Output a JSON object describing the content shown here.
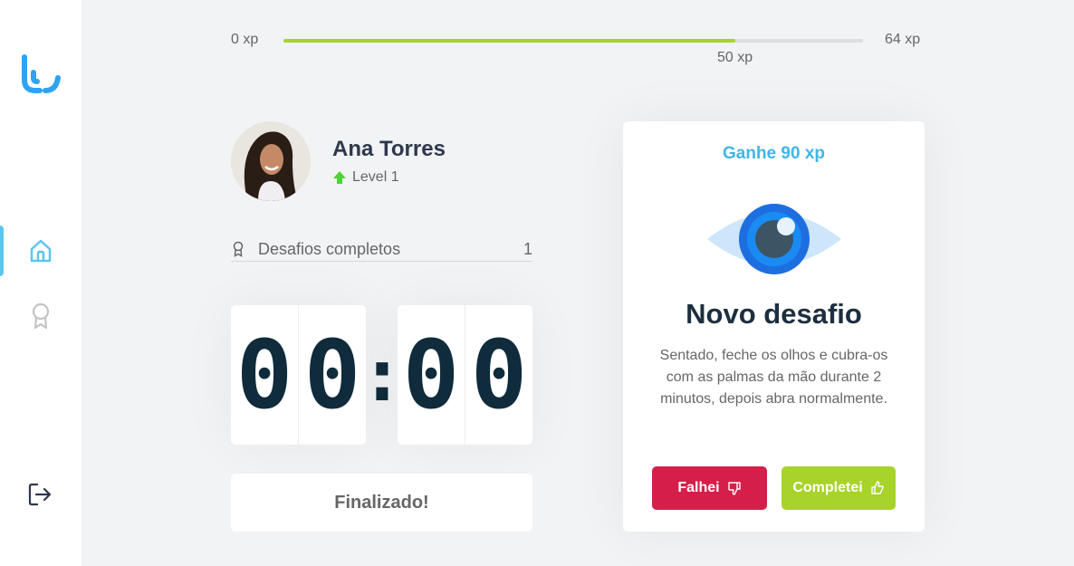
{
  "sidebar": {
    "items": [
      {
        "name": "home",
        "icon": "home-icon",
        "active": true
      },
      {
        "name": "awards",
        "icon": "award-icon",
        "active": false
      }
    ],
    "logout_icon": "logout-icon",
    "accent_color": "#5CC5F0"
  },
  "xp": {
    "min_label": "0 xp",
    "max_label": "64 xp",
    "current_label": "50 xp",
    "progress": 0.78,
    "bar_color": "#A8D32A"
  },
  "profile": {
    "name": "Ana Torres",
    "level_label": "Level 1",
    "challenges_label": "Desafios completos",
    "challenges_count": "1"
  },
  "timer": {
    "minutes": [
      "0",
      "0"
    ],
    "separator": ":",
    "seconds": [
      "0",
      "0"
    ],
    "finish_label": "Finalizado!"
  },
  "challenge": {
    "xp_label": "Ganhe 90 xp",
    "title": "Novo desafio",
    "description": "Sentado, feche os olhos e cubra-os com as palmas da mão durante 2 minutos, depois abra normalmente.",
    "icon": "eye-icon",
    "fail_label": "Falhei",
    "done_label": "Completei",
    "fail_color": "#D61E4A",
    "done_color": "#A8D32A"
  }
}
